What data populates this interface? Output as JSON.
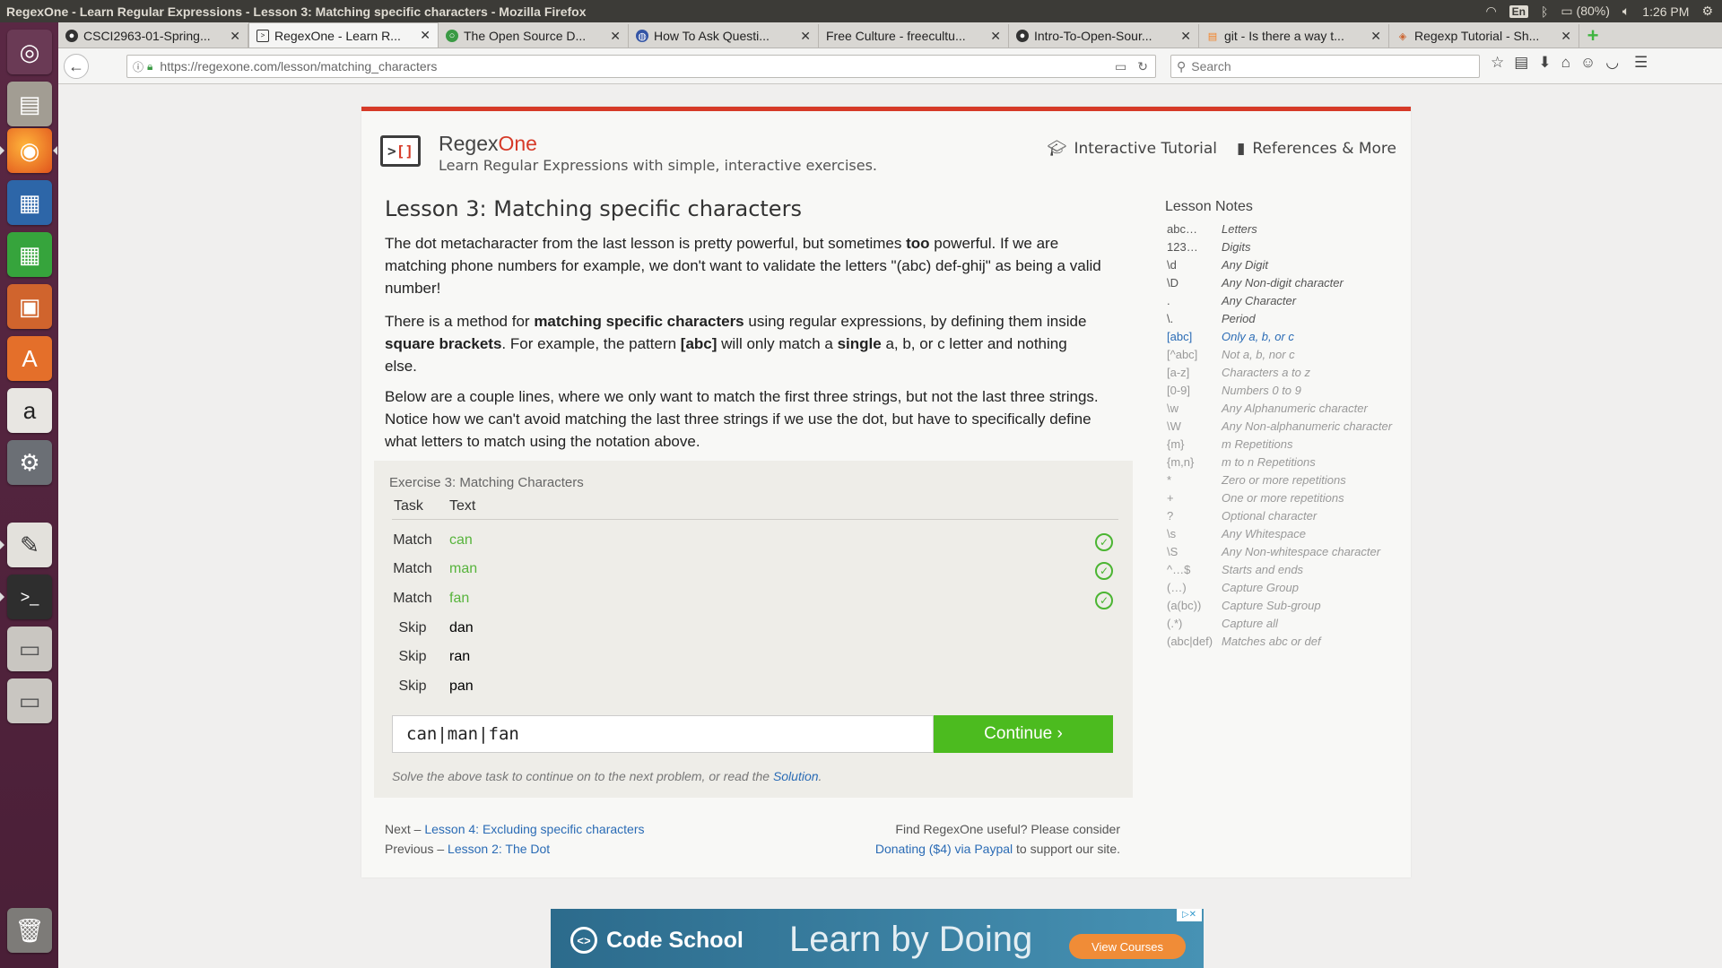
{
  "panel": {
    "window_title": "RegexOne - Learn Regular Expressions - Lesson 3: Matching specific characters - Mozilla Firefox",
    "keyboard": "En",
    "battery": "(80%)",
    "time": "1:26 PM"
  },
  "tabs": [
    {
      "label": "CSCI2963-01-Spring...",
      "active": false
    },
    {
      "label": "RegexOne - Learn R...",
      "active": true
    },
    {
      "label": "The Open Source D...",
      "active": false
    },
    {
      "label": "How To Ask Questi...",
      "active": false
    },
    {
      "label": "Free Culture - freecultu...",
      "active": false
    },
    {
      "label": "Intro-To-Open-Sour...",
      "active": false
    },
    {
      "label": "git - Is there a way t...",
      "active": false
    },
    {
      "label": "Regexp Tutorial - Sh...",
      "active": false
    }
  ],
  "nav": {
    "url": "https://regexone.com/lesson/matching_characters",
    "search_placeholder": "Search"
  },
  "site": {
    "brand_main": "Regex",
    "brand_accent": "One",
    "tagline": "Learn Regular Expressions with simple, interactive exercises.",
    "link_tutorial": "Interactive Tutorial",
    "link_references": "References & More"
  },
  "lesson": {
    "title": "Lesson 3: Matching specific characters",
    "p1": {
      "a": "The dot metacharacter from the last lesson is pretty powerful, but sometimes ",
      "b": "too",
      "c": " powerful. If we are matching phone numbers for example, we don't want to validate the letters \"(abc) def-ghij\" as being a valid number!"
    },
    "p2": {
      "a": "There is a method for ",
      "b": "matching specific characters",
      "c": " using regular expressions, by defining them inside ",
      "d": "square brackets",
      "e": ". For example, the pattern ",
      "f": "[abc]",
      "g": " will only match a ",
      "h": "single",
      "i": " a, b, or c letter and nothing else."
    },
    "p3": "Below are a couple lines, where we only want to match the first three strings, but not the last three strings. Notice how we can't avoid matching the last three strings if we use the dot, but have to specifically define what letters to match using the notation above."
  },
  "exercise": {
    "title": "Exercise 3: Matching Characters",
    "col_task": "Task",
    "col_text": "Text",
    "rows": [
      {
        "task": "Match",
        "text": "can",
        "ok": true
      },
      {
        "task": "Match",
        "text": "man",
        "ok": true
      },
      {
        "task": "Match",
        "text": "fan",
        "ok": true
      },
      {
        "task": "Skip",
        "text": "dan",
        "ok": false
      },
      {
        "task": "Skip",
        "text": "ran",
        "ok": false
      },
      {
        "task": "Skip",
        "text": "pan",
        "ok": false
      }
    ],
    "input_value": "can|man|fan",
    "continue_label": "Continue ›",
    "hint_prefix": "Solve the above task to continue on to the next problem, or read the ",
    "hint_link": "Solution",
    "hint_suffix": "."
  },
  "footer": {
    "next_prefix": "Next – ",
    "next_link": "Lesson 4: Excluding specific characters",
    "prev_prefix": "Previous – ",
    "prev_link": "Lesson 2: The Dot",
    "support_line1": "Find RegexOne useful? Please consider",
    "donate_link": "Donating ($4) via Paypal",
    "support_suffix": " to support our site."
  },
  "notes": {
    "title": "Lesson Notes",
    "items": [
      {
        "sym": "abc…",
        "desc": "Letters",
        "state": "strong"
      },
      {
        "sym": "123…",
        "desc": "Digits",
        "state": "strong"
      },
      {
        "sym": "\\d",
        "desc": "Any Digit",
        "state": "strong"
      },
      {
        "sym": "\\D",
        "desc": "Any Non-digit character",
        "state": "strong"
      },
      {
        "sym": ".",
        "desc": "Any Character",
        "state": "strong"
      },
      {
        "sym": "\\.",
        "desc": "Period",
        "state": "strong"
      },
      {
        "sym": "[abc]",
        "desc": "Only a, b, or c",
        "state": "active"
      },
      {
        "sym": "[^abc]",
        "desc": "Not a, b, nor c",
        "state": "dim"
      },
      {
        "sym": "[a-z]",
        "desc": "Characters a to z",
        "state": "dim"
      },
      {
        "sym": "[0-9]",
        "desc": "Numbers 0 to 9",
        "state": "dim"
      },
      {
        "sym": "\\w",
        "desc": "Any Alphanumeric character",
        "state": "dim"
      },
      {
        "sym": "\\W",
        "desc": "Any Non-alphanumeric character",
        "state": "dim"
      },
      {
        "sym": "{m}",
        "desc": "m Repetitions",
        "state": "dim"
      },
      {
        "sym": "{m,n}",
        "desc": "m to n Repetitions",
        "state": "dim"
      },
      {
        "sym": "*",
        "desc": "Zero or more repetitions",
        "state": "dim"
      },
      {
        "sym": "+",
        "desc": "One or more repetitions",
        "state": "dim"
      },
      {
        "sym": "?",
        "desc": "Optional character",
        "state": "dim"
      },
      {
        "sym": "\\s",
        "desc": "Any Whitespace",
        "state": "dim"
      },
      {
        "sym": "\\S",
        "desc": "Any Non-whitespace character",
        "state": "dim"
      },
      {
        "sym": "^…$",
        "desc": "Starts and ends",
        "state": "dim"
      },
      {
        "sym": "(…)",
        "desc": "Capture Group",
        "state": "dim"
      },
      {
        "sym": "(a(bc))",
        "desc": "Capture Sub-group",
        "state": "dim"
      },
      {
        "sym": "(.*)",
        "desc": "Capture all",
        "state": "dim"
      },
      {
        "sym": "(abc|def)",
        "desc": "Matches abc or def",
        "state": "dim"
      }
    ]
  },
  "ad": {
    "brand": "Code School",
    "tagline": "Learn by Doing",
    "button": "View Courses"
  },
  "colors": {
    "accent": "#d63a28",
    "success": "#4cbb1f",
    "link": "#2a6bb5"
  }
}
